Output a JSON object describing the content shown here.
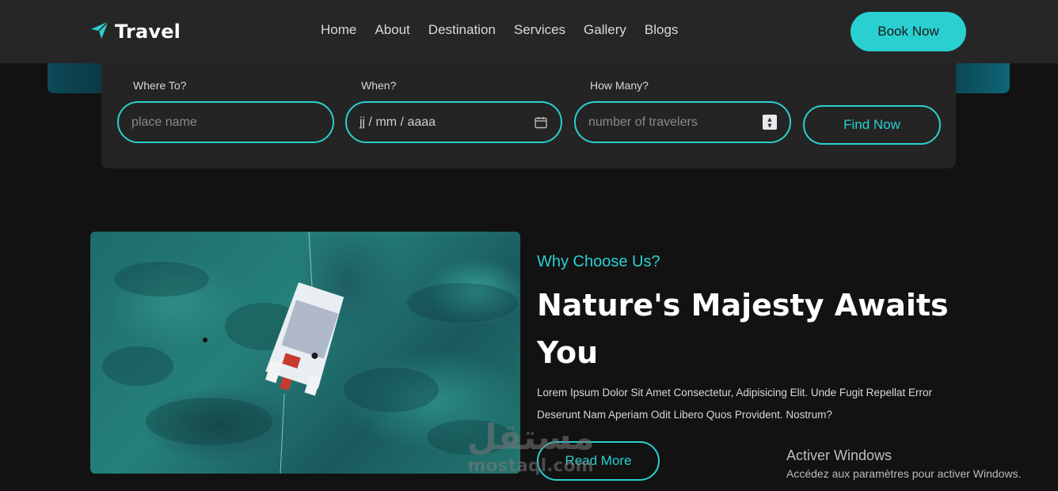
{
  "header": {
    "logo_text": "Travel",
    "nav": [
      "Home",
      "About",
      "Destination",
      "Services",
      "Gallery",
      "Blogs"
    ],
    "cta_label": "Book Now"
  },
  "search": {
    "where_label": "Where To?",
    "where_placeholder": "place name",
    "when_label": "When?",
    "when_value": "jj / mm / aaaa",
    "how_many_label": "How Many?",
    "how_many_placeholder": "number of travelers",
    "find_label": "Find Now"
  },
  "about": {
    "subtitle": "Why Choose Us?",
    "heading": "Nature's Majesty Awaits You",
    "body": "Lorem Ipsum Dolor Sit Amet Consectetur, Adipisicing Elit. Unde Fugit Repellat Error Deserunt Nam Aperiam Odit Libero Quos Provident. Nostrum?",
    "read_more_label": "Read More"
  },
  "watermark": {
    "arabic": "مستقل",
    "latin": "mostaql.com"
  },
  "os_notice": {
    "title": "Activer Windows",
    "subtitle": "Accédez aux paramètres pour activer Windows."
  },
  "colors": {
    "accent": "#2ad0d0",
    "background": "#121212",
    "navbar": "#262626",
    "panel": "#242424"
  }
}
